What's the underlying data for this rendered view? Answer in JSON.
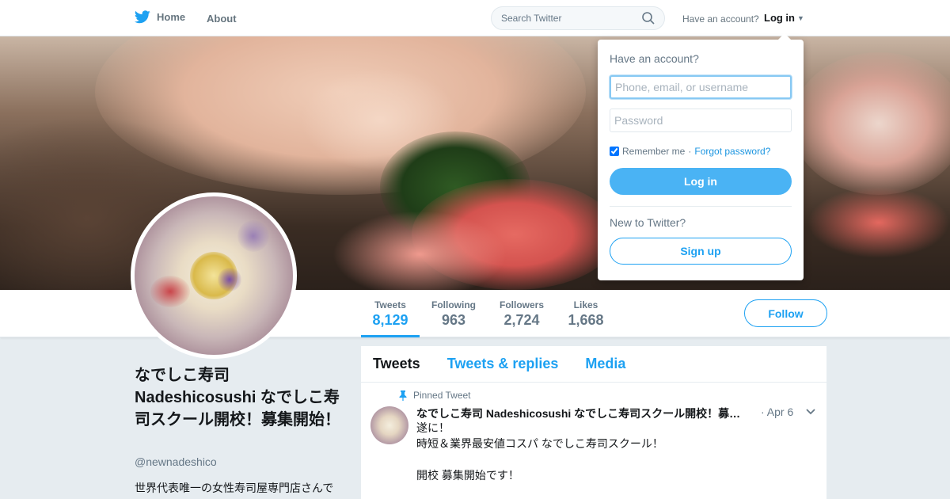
{
  "topbar": {
    "home_label": "Home",
    "about_label": "About",
    "search_placeholder": "Search Twitter",
    "have_account": "Have an account?",
    "login_label": "Log in"
  },
  "profile": {
    "name": "なでしこ寿司 Nadeshicosushi なでしこ寿司スクール開校！募集開始！",
    "handle": "@newnadeshico",
    "bio": "世界代表唯一の女性寿司屋専門店さんで"
  },
  "stats": [
    {
      "label": "Tweets",
      "value": "8,129"
    },
    {
      "label": "Following",
      "value": "963"
    },
    {
      "label": "Followers",
      "value": "2,724"
    },
    {
      "label": "Likes",
      "value": "1,668"
    }
  ],
  "follow_label": "Follow",
  "timeline": {
    "tabs": [
      "Tweets",
      "Tweets & replies",
      "Media"
    ],
    "pinned_label": "Pinned Tweet",
    "tweet": {
      "author": "なでしこ寿司 Nadeshicosushi なでしこ寿司スクール開校！募…",
      "date": "· Apr 6",
      "body": "遂に！\n時短＆業界最安値コスパ  なでしこ寿司スクール！\n\n開校  募集開始です！"
    }
  },
  "login_dropdown": {
    "heading": "Have an account?",
    "username_placeholder": "Phone, email, or username",
    "password_placeholder": "Password",
    "remember_label": "Remember me",
    "separator": "·",
    "forgot_label": "Forgot password?",
    "login_button": "Log in",
    "new_label": "New to Twitter?",
    "signup_button": "Sign up"
  },
  "colors": {
    "accent": "#1da1f2",
    "login_button": "#4ab3f4",
    "background": "#e6ecf0"
  }
}
